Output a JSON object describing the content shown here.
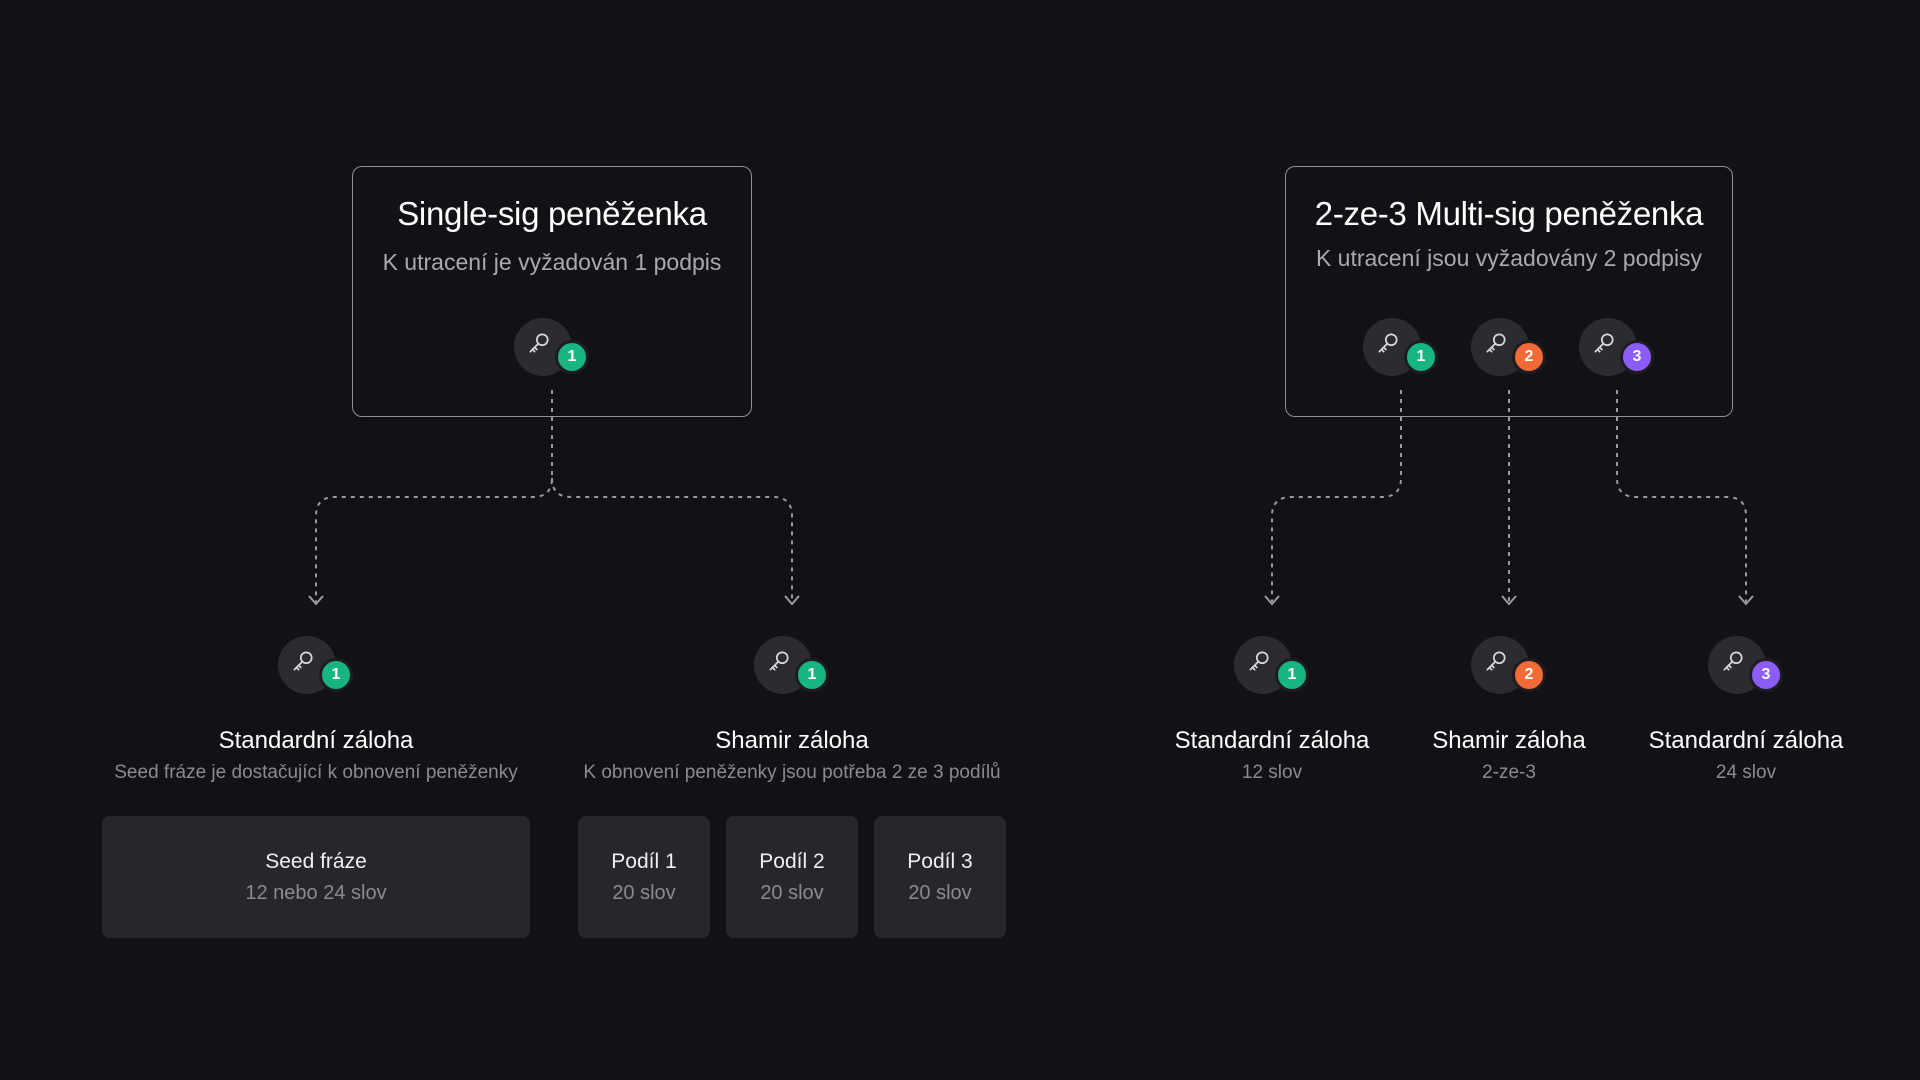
{
  "colors": {
    "background": "#121216",
    "badge_1": "#17b581",
    "badge_2": "#f26a36",
    "badge_3": "#8b5cf6",
    "connector": "#9a9aa2"
  },
  "icons": {
    "key": "key-icon"
  },
  "single_sig": {
    "title": "Single-sig peněženka",
    "subtitle": "K utracení je vyžadován 1 podpis",
    "keys": [
      "1"
    ],
    "outputs": [
      {
        "badge": "1",
        "title": "Standardní záloha",
        "subtitle": "Seed fráze je dostačující k obnovení peněženky",
        "cards": [
          {
            "title": "Seed fráze",
            "subtitle": "12 nebo 24 slov"
          }
        ]
      },
      {
        "badge": "1",
        "title": "Shamir záloha",
        "subtitle": "K obnovení peněženky jsou potřeba 2 ze 3 podílů",
        "cards": [
          {
            "title": "Podíl 1",
            "subtitle": "20 slov"
          },
          {
            "title": "Podíl 2",
            "subtitle": "20 slov"
          },
          {
            "title": "Podíl 3",
            "subtitle": "20 slov"
          }
        ]
      }
    ]
  },
  "multi_sig": {
    "title": "2-ze-3 Multi-sig peněženka",
    "subtitle": "K utracení jsou vyžadovány 2 podpisy",
    "keys": [
      "1",
      "2",
      "3"
    ],
    "outputs": [
      {
        "badge": "1",
        "title": "Standardní záloha",
        "subtitle": "12 slov"
      },
      {
        "badge": "2",
        "title": "Shamir záloha",
        "subtitle": "2-ze-3"
      },
      {
        "badge": "3",
        "title": "Standardní záloha",
        "subtitle": "24 slov"
      }
    ]
  }
}
